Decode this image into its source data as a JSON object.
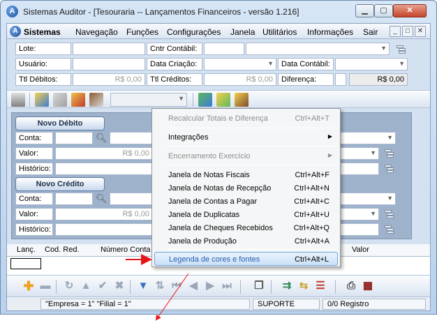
{
  "window": {
    "title": "Sistemas Auditor - [Tesouraria -- Lançamentos Financeiros - versão 1.216]"
  },
  "menubar": {
    "items": [
      "Sistemas",
      "Navegação",
      "Funções",
      "Configurações",
      "Janela",
      "Utilitários",
      "Informações",
      "Sair"
    ]
  },
  "header_fields": {
    "lote": "Lote:",
    "ctr_contabil": "Cntr Contábil:",
    "usuario": "Usuário:",
    "data_criacao": "Data Criação:",
    "data_contabil": "Data Contábil:",
    "ttl_debitos": "Ttl Débitos:",
    "ttl_debitos_value": "R$ 0,00",
    "ttl_creditos": "Ttl Créditos:",
    "ttl_creditos_value": "R$ 0,00",
    "diferenca": "Diferença:",
    "diferenca_value": "R$ 0,00"
  },
  "debito": {
    "title": "Novo Débito",
    "conta": "Conta:",
    "valor": "Valor:",
    "valor_value": "R$ 0,00",
    "historico": "Histórico:"
  },
  "credito": {
    "title": "Novo Crédito",
    "conta": "Conta:",
    "valor": "Valor:",
    "valor_value": "R$ 0,00",
    "historico": "Histórico:"
  },
  "grid": {
    "columns": [
      "Lanç.",
      "Cod. Red.",
      "Número Conta",
      "Valor"
    ]
  },
  "status": {
    "empresa": "\"Empresa = 1\"   \"Filial = 1\"",
    "user": "SUPORTE",
    "registro": "0/0 Registro"
  },
  "context_menu": {
    "items": [
      {
        "label": "Recalcular Totais e Diferença",
        "shortcut": "Ctrl+Alt+T",
        "disabled": true
      },
      {
        "label": "Integrações",
        "submenu": true
      },
      {
        "label": "Encerramento Exercício",
        "submenu": true,
        "disabled": true
      },
      {
        "label": "Janela de Notas Fiscais",
        "shortcut": "Ctrl+Alt+F"
      },
      {
        "label": "Janela de Notas de Recepção",
        "shortcut": "Ctrl+Alt+N"
      },
      {
        "label": "Janela de Contas a Pagar",
        "shortcut": "Ctrl+Alt+C"
      },
      {
        "label": "Janela de Duplicatas",
        "shortcut": "Ctrl+Alt+U"
      },
      {
        "label": "Janela de Cheques Recebidos",
        "shortcut": "Ctrl+Alt+Q"
      },
      {
        "label": "Janela de Produção",
        "shortcut": "Ctrl+Alt+A"
      },
      {
        "label": "Legenda de cores e fontes",
        "shortcut": "Ctrl+Alt+L",
        "highlighted": true
      }
    ]
  },
  "colors": {
    "accent": "#6fa3d9",
    "annotation": "#e8141b"
  }
}
